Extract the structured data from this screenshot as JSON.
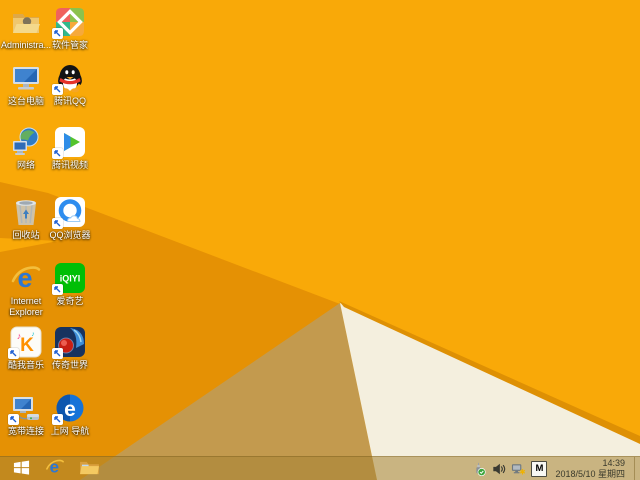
{
  "wallpaper": {
    "colors": {
      "base": "#F9A908",
      "fold_dark": "#E59104",
      "shadow_tan": "#C39A4E",
      "sheet_white": "#F4EFDE",
      "edge_stripe": "#DE9004"
    }
  },
  "desktop_icons": [
    {
      "label": "Administra...",
      "shortcut": false
    },
    {
      "label": "软件管家",
      "shortcut": true
    },
    {
      "label": "这台电脑",
      "shortcut": false
    },
    {
      "label": "腾讯QQ",
      "shortcut": true
    },
    {
      "label": "网络",
      "shortcut": false
    },
    {
      "label": "腾讯视频",
      "shortcut": true
    },
    {
      "label": "回收站",
      "shortcut": false
    },
    {
      "label": "QQ浏览器",
      "shortcut": true
    },
    {
      "label": "Internet Explorer",
      "shortcut": false
    },
    {
      "label": "爱奇艺",
      "shortcut": true
    },
    {
      "label": "酷我音乐",
      "shortcut": true
    },
    {
      "label": "传奇世界",
      "shortcut": true
    },
    {
      "label": "宽带连接",
      "shortcut": true
    },
    {
      "label": "上网 导航",
      "shortcut": true
    }
  ],
  "taskbar": {
    "tray": {
      "time": "14:39",
      "date": "2018/5/10 星期四",
      "ime": "M"
    }
  }
}
